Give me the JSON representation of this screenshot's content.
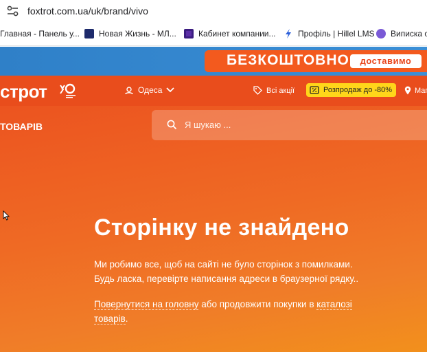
{
  "browser": {
    "url": "foxtrot.com.ua/uk/brand/vivo"
  },
  "bookmarks": [
    {
      "label": "Главная - Панель у..."
    },
    {
      "label": "Новая Жизнь - МЛ..."
    },
    {
      "label": "Кабинет компании..."
    },
    {
      "label": "Профіль | Hillel LMS"
    },
    {
      "label": "Виписка о"
    }
  ],
  "promo": {
    "headline": "БЕЗКОШТОВНО",
    "button": "доставимо"
  },
  "header": {
    "logo": "строт",
    "city": "Одеса",
    "promotions": "Всі акції",
    "sale": "Розпродаж до -80%",
    "stores": "Маг"
  },
  "nav": {
    "catalog": "ТОВАРІВ",
    "search_placeholder": "Я шукаю ..."
  },
  "error": {
    "title": "Сторінку не знайдено",
    "line1": "Ми робимо все, щоб на сайті не було сторінок з помилками.",
    "line2": "Будь ласка, перевірте написання адреси в браузерної рядку..",
    "link_home": "Повернутися на головну",
    "middle": " або продовжити покупки в ",
    "link_catalog_a": "каталозі",
    "link_catalog_b": "товарів",
    "end": "."
  },
  "colors": {
    "brand_orange": "#e94d1c",
    "promo_blue": "#2f80c8",
    "sale_yellow": "#ffd61a"
  }
}
